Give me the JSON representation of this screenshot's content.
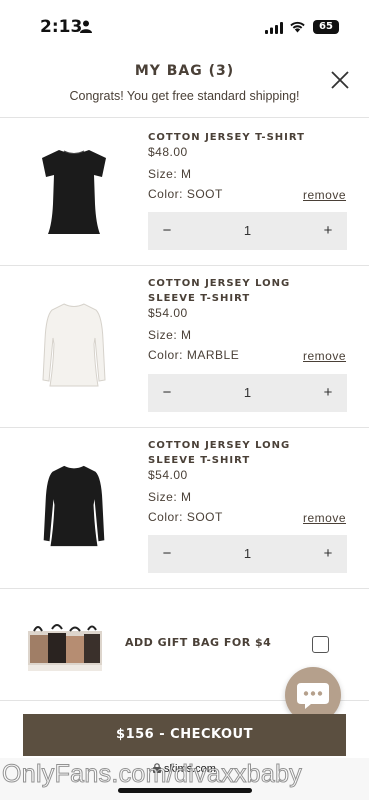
{
  "status_bar": {
    "time": "2:13",
    "battery": "65"
  },
  "header": {
    "title": "MY BAG (3)",
    "message": "Congrats! You get free standard shipping!"
  },
  "items": [
    {
      "name": "COTTON JERSEY T-SHIRT",
      "price": "$48.00",
      "size": "Size: M",
      "color": "Color: SOOT",
      "remove": "remove",
      "minus": "−",
      "qty": "1",
      "plus": "+",
      "swatch": "#1a1a1a"
    },
    {
      "name": "COTTON JERSEY LONG SLEEVE T-SHIRT",
      "price": "$54.00",
      "size": "Size: M",
      "color": "Color: MARBLE",
      "remove": "remove",
      "minus": "−",
      "qty": "1",
      "plus": "+",
      "swatch": "#f3f1ec"
    },
    {
      "name": "COTTON JERSEY LONG SLEEVE T-SHIRT",
      "price": "$54.00",
      "size": "Size: M",
      "color": "Color: SOOT",
      "remove": "remove",
      "minus": "−",
      "qty": "1",
      "plus": "+",
      "swatch": "#1a1a1a"
    }
  ],
  "gift_bag": {
    "label": "ADD GIFT BAG FOR $4",
    "checked": false
  },
  "checkout": {
    "label": "$156 - CHECKOUT"
  },
  "browser": {
    "url": "skims.com"
  },
  "watermark": "OnlyFans.com/divaxxbaby",
  "colors": {
    "accent": "#5b4f40",
    "text": "#4a4037",
    "chat": "#b5a08c",
    "stepper_bg": "#ececec"
  }
}
